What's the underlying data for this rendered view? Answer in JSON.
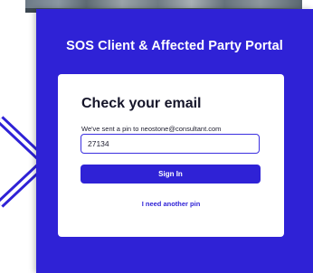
{
  "portal": {
    "title": "SOS Client & Affected Party Portal"
  },
  "card": {
    "heading": "Check your email",
    "subtext": "We've sent a pin to neostone@consultant.com",
    "pin_value": "27134",
    "signin_label": "Sign In",
    "another_pin_label": "I need another pin"
  },
  "colors": {
    "brand_blue": "#2f22d6",
    "card_background": "#ffffff"
  },
  "icons": {
    "left_arrow": "chevron-right-icon"
  }
}
